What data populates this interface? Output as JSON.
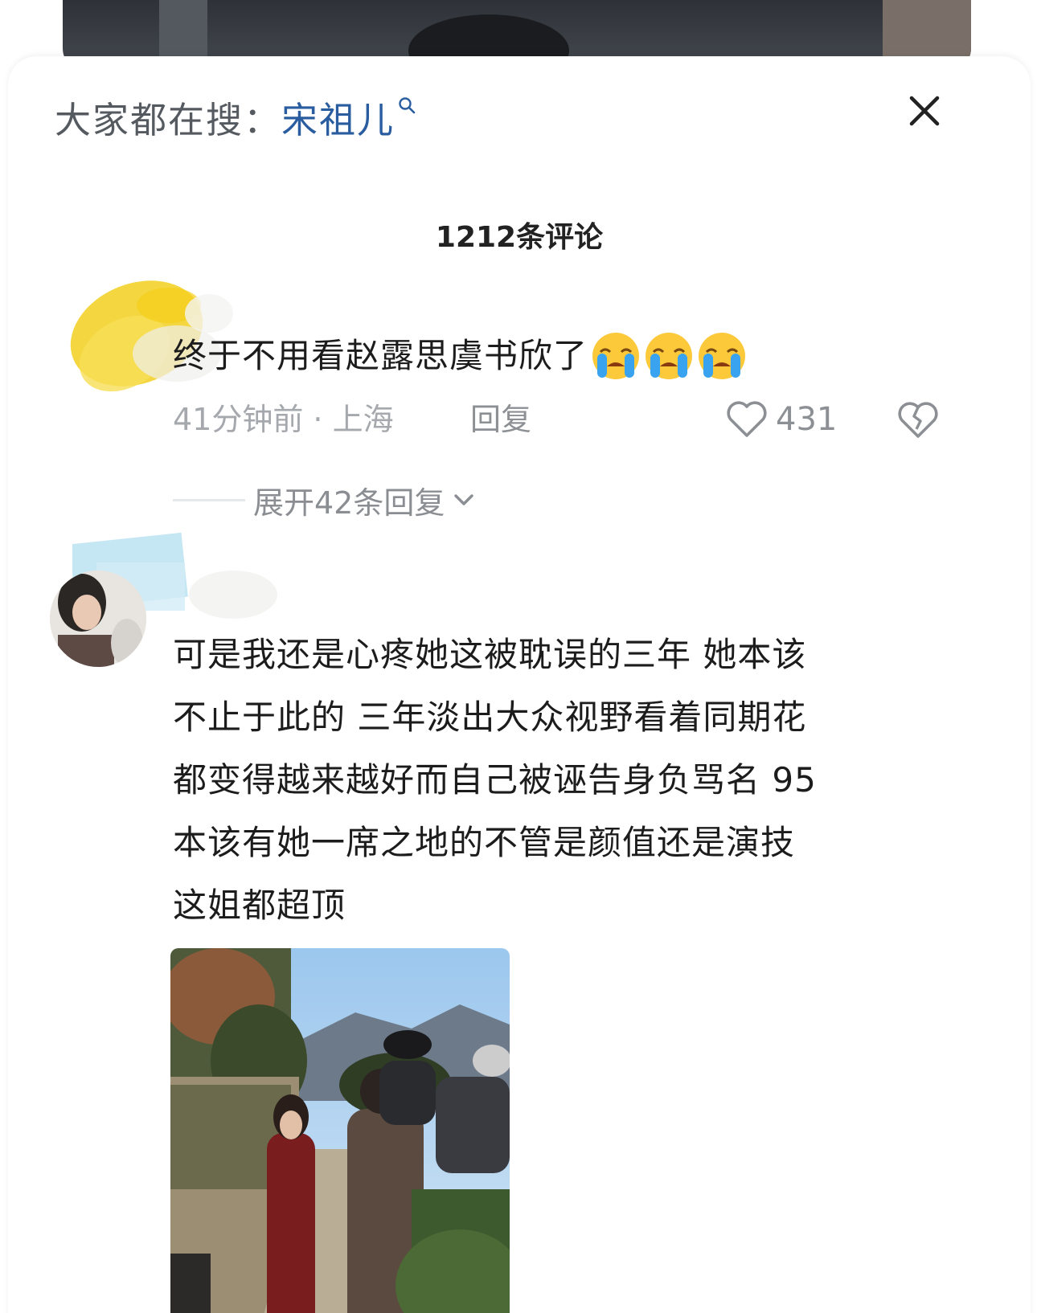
{
  "search": {
    "prefix": "大家都在搜：",
    "term": "宋祖儿",
    "term_icon": "search-icon"
  },
  "close_icon": "close-icon",
  "comments_header": {
    "count_label": "1212条评论"
  },
  "comments": [
    {
      "text": "终于不用看赵露思虞书欣了",
      "emojis": [
        "crying-face-icon",
        "crying-face-icon",
        "crying-face-icon"
      ],
      "time_location": "41分钟前 · 上海",
      "reply_label": "回复",
      "like_count": "431",
      "expand_label": "展开42条回复"
    },
    {
      "text_lines": [
        "可是我还是心疼她这被耽误的三年 她本该",
        "不止于此的 三年淡出大众视野看着同期花",
        "都变得越来越好而自己被诬告身负骂名 95",
        "本该有她一席之地的不管是颜值还是演技",
        "这姐都超顶"
      ],
      "image": "photo-street-scene"
    }
  ],
  "colors": {
    "search_term": "#2a5d9f",
    "meta_text": "#a5a8ad",
    "body_text": "#1c1c1c"
  }
}
